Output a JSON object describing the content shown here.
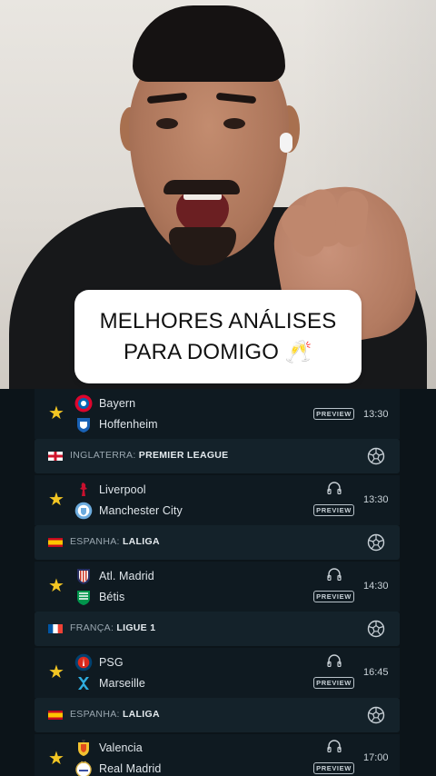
{
  "caption": {
    "line1": "MELHORES ANÁLISES",
    "line2": "PARA DOMIGO 🥂"
  },
  "matches": [
    {
      "home": "Bayern",
      "away": "Hoffenheim",
      "time": "13:30",
      "favorite": true,
      "preview": "PREVIEW",
      "home_icon": "bayern-crest",
      "away_icon": "hoffenheim-crest"
    },
    {
      "home": "Liverpool",
      "away": "Manchester City",
      "time": "13:30",
      "favorite": true,
      "preview": "PREVIEW",
      "home_icon": "liverpool-crest",
      "away_icon": "man-city-crest"
    },
    {
      "home": "Atl. Madrid",
      "away": "Bétis",
      "time": "14:30",
      "favorite": true,
      "preview": "PREVIEW",
      "home_icon": "atletico-crest",
      "away_icon": "betis-crest"
    },
    {
      "home": "PSG",
      "away": "Marseille",
      "time": "16:45",
      "favorite": true,
      "preview": "PREVIEW",
      "home_icon": "psg-crest",
      "away_icon": "marseille-crest"
    },
    {
      "home": "Valencia",
      "away": "Real Madrid",
      "time": "17:00",
      "favorite": true,
      "preview": "PREVIEW",
      "home_icon": "valencia-crest",
      "away_icon": "real-madrid-crest"
    }
  ],
  "leagues": [
    {
      "country": "INGLATERRA:",
      "name": "PREMIER LEAGUE",
      "flag": "england-flag"
    },
    {
      "country": "ESPANHA:",
      "name": "LALIGA",
      "flag": "spain-flag"
    },
    {
      "country": "FRANÇA:",
      "name": "LIGUE 1",
      "flag": "france-flag"
    },
    {
      "country": "ESPANHA:",
      "name": "LALIGA",
      "flag": "spain-flag"
    }
  ],
  "colors": {
    "background": "#0c1419",
    "league_bar": "#14222a",
    "star": "#f3c623",
    "text": "#dfe5ea"
  }
}
